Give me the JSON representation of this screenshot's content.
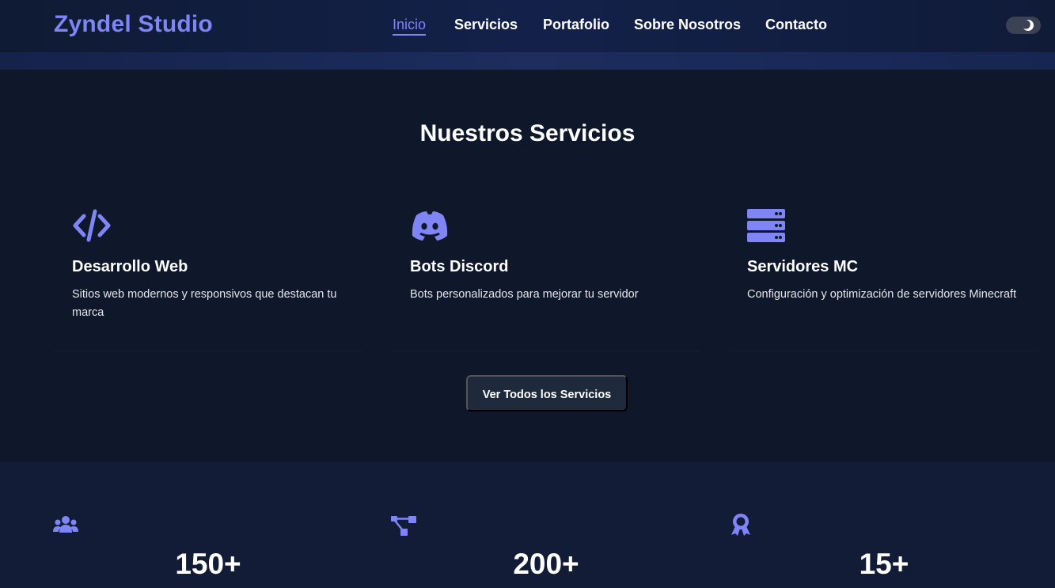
{
  "brand": "Zyndel Studio",
  "nav": {
    "links": [
      "Inicio",
      "Servicios",
      "Portafolio",
      "Sobre Nosotros",
      "Contacto"
    ],
    "active": "Inicio"
  },
  "theme_toggle_icon": "moon-icon",
  "services": {
    "title": "Nuestros Servicios",
    "cards": [
      {
        "icon": "code-icon",
        "title": "Desarrollo Web",
        "description": "Sitios web modernos y responsivos que destacan tu marca"
      },
      {
        "icon": "discord-icon",
        "title": "Bots Discord",
        "description": "Bots personalizados para mejorar tu servidor"
      },
      {
        "icon": "server-icon",
        "title": "Servidores MC",
        "description": "Configuración y optimización de servidores Minecraft"
      }
    ],
    "button_label": "Ver Todos los Servicios"
  },
  "stats": [
    {
      "icon": "users-icon",
      "value": "150+"
    },
    {
      "icon": "project-diagram-icon",
      "value": "200+"
    },
    {
      "icon": "award-icon",
      "value": "15+"
    }
  ],
  "colors": {
    "accent": "#7f85f5",
    "background": "#0f172a",
    "stats_background": "#131c36",
    "button": "#1e293b"
  }
}
